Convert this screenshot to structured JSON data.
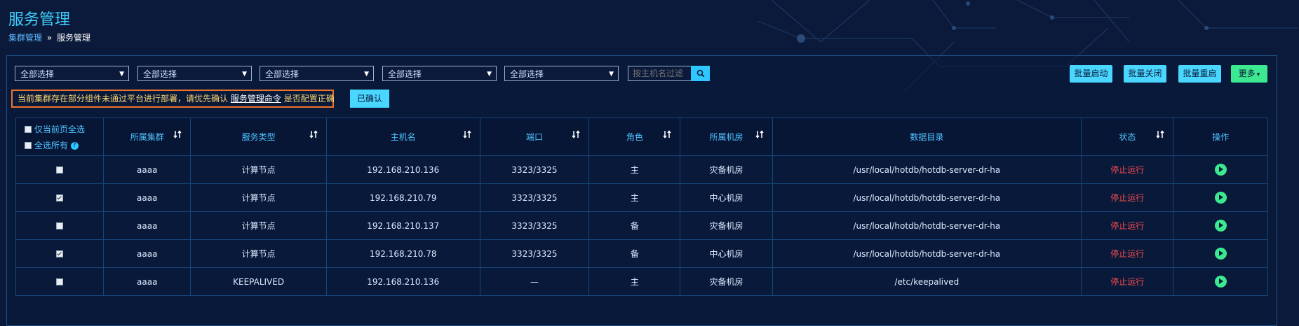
{
  "page": {
    "title": "服务管理",
    "breadcrumb": {
      "parent": "集群管理",
      "separator": "»",
      "current": "服务管理"
    }
  },
  "filters": [
    {
      "selected": "全部选择"
    },
    {
      "selected": "全部选择"
    },
    {
      "selected": "全部选择"
    },
    {
      "selected": "全部选择"
    },
    {
      "selected": "全部选择"
    }
  ],
  "search": {
    "placeholder": "按主机名过滤",
    "icon": "search-icon"
  },
  "toolbar": {
    "batch_start": "批量启动",
    "batch_stop": "批量关闭",
    "batch_restart": "批量重启",
    "more": "更多",
    "more_caret": "▾"
  },
  "warning": {
    "text_before": "当前集群存在部分组件未通过平台进行部署，请优先确认",
    "link": "服务管理命令",
    "text_after": "是否配置正确",
    "confirm_label": "已确认"
  },
  "table": {
    "select_page_label": "仅当前页全选",
    "select_all_label": "全选所有",
    "help_glyph": "?",
    "headers": [
      "所属集群",
      "服务类型",
      "主机名",
      "端口",
      "角色",
      "所属机房",
      "数据目录",
      "状态",
      "操作"
    ],
    "rows": [
      {
        "checked": false,
        "cluster": "aaaa",
        "type": "计算节点",
        "host": "192.168.210.136",
        "port": "3323/3325",
        "role": "主",
        "room": "灾备机房",
        "dir": "/usr/local/hotdb/hotdb-server-dr-ha",
        "status": "停止运行"
      },
      {
        "checked": true,
        "cluster": "aaaa",
        "type": "计算节点",
        "host": "192.168.210.79",
        "port": "3323/3325",
        "role": "主",
        "room": "中心机房",
        "dir": "/usr/local/hotdb/hotdb-server-dr-ha",
        "status": "停止运行"
      },
      {
        "checked": false,
        "cluster": "aaaa",
        "type": "计算节点",
        "host": "192.168.210.137",
        "port": "3323/3325",
        "role": "备",
        "room": "灾备机房",
        "dir": "/usr/local/hotdb/hotdb-server-dr-ha",
        "status": "停止运行"
      },
      {
        "checked": true,
        "cluster": "aaaa",
        "type": "计算节点",
        "host": "192.168.210.78",
        "port": "3323/3325",
        "role": "备",
        "room": "中心机房",
        "dir": "/usr/local/hotdb/hotdb-server-dr-ha",
        "status": "停止运行"
      },
      {
        "checked": false,
        "cluster": "aaaa",
        "type": "KEEPALIVED",
        "host": "192.168.210.136",
        "port": "—",
        "role": "主",
        "room": "灾备机房",
        "dir": "/etc/keepalived",
        "status": "停止运行"
      }
    ]
  },
  "colors": {
    "background": "#0b1a3a",
    "accent": "#49d6ff",
    "success": "#3ce890",
    "danger": "#ff4d4d",
    "warning_border": "#f0732d"
  }
}
